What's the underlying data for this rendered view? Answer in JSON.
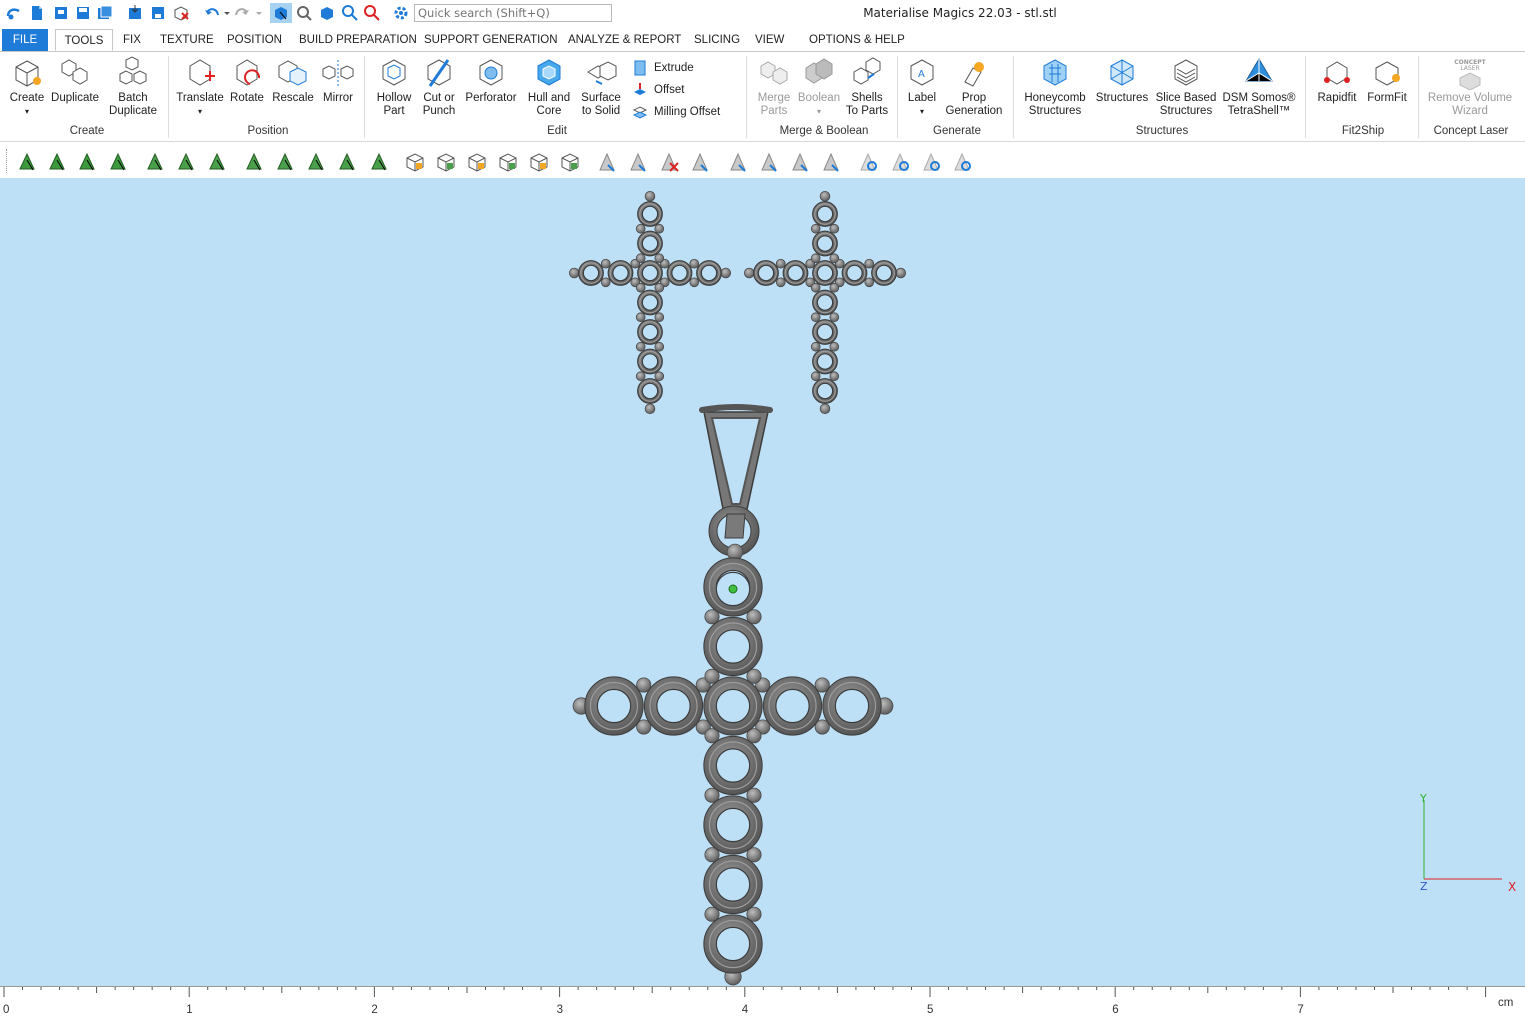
{
  "window": {
    "title": "Materialise Magics 22.03 - stl.stl"
  },
  "search": {
    "placeholder": "Quick search (Shift+Q)"
  },
  "tabs": [
    "FILE",
    "TOOLS",
    "FIX",
    "TEXTURE",
    "POSITION",
    "BUILD PREPARATION",
    "SUPPORT GENERATION",
    "ANALYZE & REPORT",
    "SLICING",
    "VIEW",
    "OPTIONS & HELP"
  ],
  "ribbon": {
    "create": {
      "create": "Create",
      "duplicate": "Duplicate",
      "batch_duplicate_1": "Batch",
      "batch_duplicate_2": "Duplicate",
      "group": "Create"
    },
    "position": {
      "translate": "Translate",
      "rotate": "Rotate",
      "rescale": "Rescale",
      "mirror": "Mirror",
      "group": "Position"
    },
    "edit": {
      "hollow_1": "Hollow",
      "hollow_2": "Part",
      "cut_1": "Cut or",
      "cut_2": "Punch",
      "perforator": "Perforator",
      "hull_1": "Hull and",
      "hull_2": "Core",
      "surface_1": "Surface",
      "surface_2": "to Solid",
      "extrude": "Extrude",
      "offset": "Offset",
      "milling_offset": "Milling Offset",
      "group": "Edit"
    },
    "merge": {
      "merge_1": "Merge",
      "merge_2": "Parts",
      "boolean": "Boolean",
      "shells_1": "Shells",
      "shells_2": "To Parts",
      "group": "Merge & Boolean"
    },
    "generate": {
      "label": "Label",
      "prop_1": "Prop",
      "prop_2": "Generation",
      "group": "Generate"
    },
    "structures": {
      "honeycomb_1": "Honeycomb",
      "honeycomb_2": "Structures",
      "structures": "Structures",
      "slice_1": "Slice Based",
      "slice_2": "Structures",
      "dsm_1": "DSM Somos®",
      "dsm_2": "TetraShell™",
      "group": "Structures"
    },
    "fit2ship": {
      "rapidfit": "Rapidfit",
      "formfit": "FormFit",
      "group": "Fit2Ship"
    },
    "concept": {
      "remove_1": "Remove Volume",
      "remove_2": "Wizard",
      "logo_1": "CONCEPT",
      "logo_2": "LASER",
      "group": "Concept Laser"
    }
  },
  "ruler": {
    "labels": [
      "0",
      "1",
      "2",
      "3",
      "4",
      "5",
      "6",
      "7"
    ],
    "unit": "cm"
  },
  "axes": {
    "x": "X",
    "y": "Y",
    "z": "Z"
  },
  "colors": {
    "accent": "#1e7bd7",
    "viewport_bg": "#bde0f7",
    "model": "#8a8a8a"
  }
}
